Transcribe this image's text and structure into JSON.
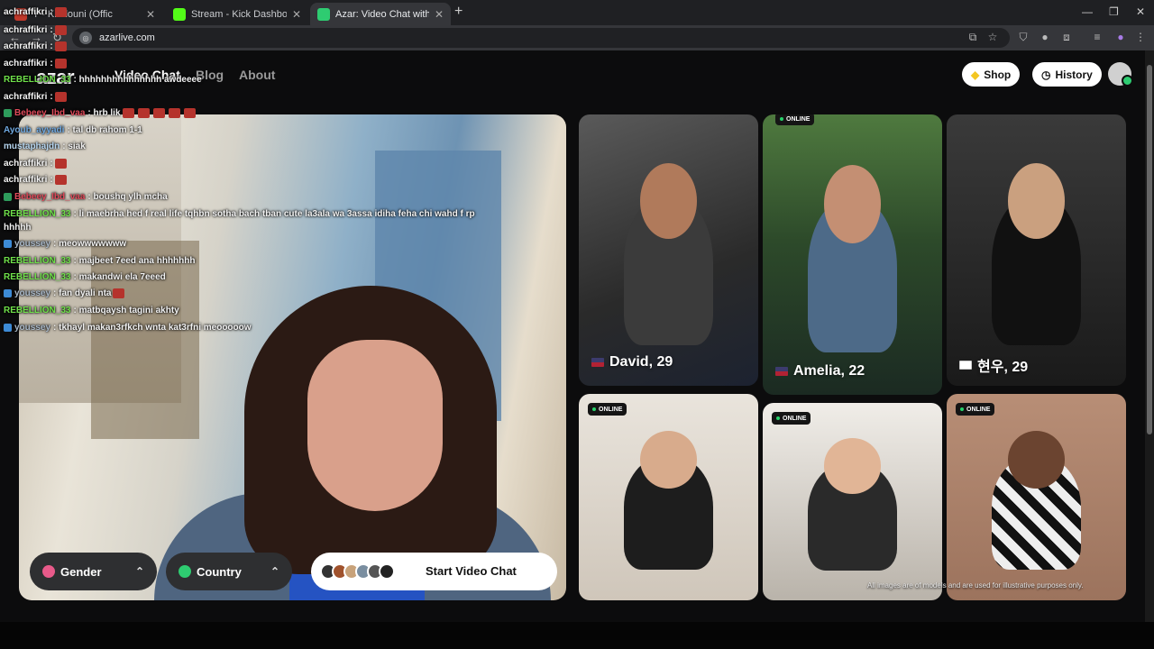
{
  "browser": {
    "tabs": [
      {
        "title": "Y - Khelouni (Offic",
        "fav_color": "#c0392b",
        "left": 0
      },
      {
        "title": "Stream - Kick Dashboard",
        "fav_color": "#53fc18",
        "left": 0
      },
      {
        "title": "Azar: Video Chat with New",
        "fav_color": "#2ecc71",
        "left": 0
      }
    ],
    "url": "azarlive.com"
  },
  "site": {
    "logo": "azar",
    "nav": {
      "video_chat": "Video Chat",
      "blog": "Blog",
      "about": "About"
    },
    "shop_label": "Shop",
    "history_label": "History",
    "filters": {
      "gender": "Gender",
      "country": "Country"
    },
    "start_label": "Start Video Chat",
    "disclaimer": "All images are of models and are used for illustrative purposes only.",
    "online_label": "ONLINE",
    "profiles": [
      {
        "name": "David, 29",
        "online": false
      },
      {
        "name": "Amelia, 22",
        "online": true
      },
      {
        "name": "현우, 29",
        "online": false
      },
      {
        "name": "",
        "online": true
      },
      {
        "name": "",
        "online": true
      },
      {
        "name": "",
        "online": true
      }
    ]
  },
  "chat": [
    {
      "user": "achraffikri",
      "user_color": "#f2f2f2",
      "text": ":",
      "emotes": 1
    },
    {
      "user": "achraffikri",
      "user_color": "#f2f2f2",
      "text": ":",
      "emotes": 1
    },
    {
      "user": "achraffikri",
      "user_color": "#f2f2f2",
      "text": ":",
      "emotes": 1
    },
    {
      "user": "achraffikri",
      "user_color": "#f2f2f2",
      "text": ":",
      "emotes": 1
    },
    {
      "user": "REBELLION_33",
      "user_color": "#6fe04a",
      "text": ": hhhhhhhhhhhhhhh awdeeee",
      "emotes": 0
    },
    {
      "user": "achraffikri",
      "user_color": "#f2f2f2",
      "text": ":",
      "emotes": 1
    },
    {
      "user": "Bebeey_Ibd_vaa",
      "user_color": "#e04a5a",
      "text": ": hrb lik",
      "emotes": 5
    },
    {
      "user": "Ayoub_ayyadi",
      "user_color": "#6fa8e0",
      "text": ": tal db rahom 1-1",
      "emotes": 0
    },
    {
      "user": "mustaphajdn",
      "user_color": "#b7d6f0",
      "text": ": siak",
      "emotes": 0
    },
    {
      "user": "achraffikri",
      "user_color": "#f2f2f2",
      "text": ":",
      "emotes": 1
    },
    {
      "user": "achraffikri",
      "user_color": "#f2f2f2",
      "text": ":",
      "emotes": 1
    },
    {
      "user": "Bebeey_Ibd_vaa",
      "user_color": "#e04a5a",
      "text": ": boushq ylh mcha",
      "emotes": 0
    },
    {
      "user": "REBELLION_33",
      "user_color": "#6fe04a",
      "text": ": li maebrha hed f real life tqhbn sotha bach tban cute la3ala wa 3assa idiha feha chi wahd f rp",
      "emotes": 0
    },
    {
      "user": "",
      "user_color": "#f2f2f2",
      "text": "hhhhh",
      "emotes": 0
    },
    {
      "user": "youssey",
      "user_color": "#a9b8c8",
      "text": ": meowwwwwww",
      "emotes": 0
    },
    {
      "user": "REBELLION_33",
      "user_color": "#6fe04a",
      "text": ": majbeet 7eed ana hhhhhhh",
      "emotes": 0
    },
    {
      "user": "REBELLION_33",
      "user_color": "#6fe04a",
      "text": ": makandwi ela 7eeed",
      "emotes": 0
    },
    {
      "user": "youssey",
      "user_color": "#a9b8c8",
      "text": ": fan dyali nta",
      "emotes": 1
    },
    {
      "user": "REBELLION_33",
      "user_color": "#6fe04a",
      "text": ": matbqaysh tagini akhty",
      "emotes": 0
    },
    {
      "user": "youssey",
      "user_color": "#a9b8c8",
      "text": ": tkhayl makan3rfkch wnta kat3rfni meooooow",
      "emotes": 0
    }
  ]
}
